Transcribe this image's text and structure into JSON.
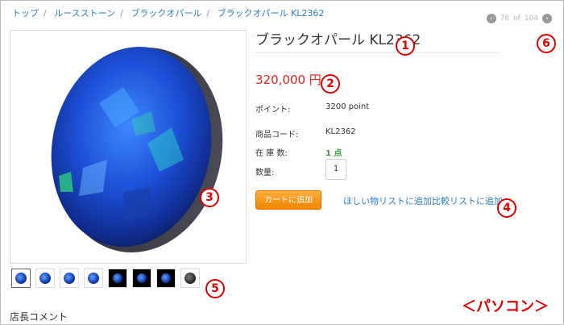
{
  "breadcrumb": [
    "トップ",
    "ルースストーン",
    "ブラックオパール",
    "ブラックオパール KL2362"
  ],
  "pager": {
    "current": "76",
    "of_text": "of",
    "total": "104",
    "prev_icon": "chevron-left-icon",
    "next_icon": "chevron-right-icon"
  },
  "product": {
    "title": "ブラックオパール KL2362",
    "price": "320,000 円",
    "points_label": "ポイント:",
    "points_value": "3200 point",
    "code_label": "商品コード:",
    "code_value": "KL2362",
    "stock_label": "在 庫 数:",
    "stock_value": "1 点",
    "qty_label": "数量:",
    "qty_value": "1"
  },
  "actions": {
    "cart_label": "カートに追加",
    "wishlist_label": "ほしい物リストに追加",
    "compare_label": "比較リストに追加"
  },
  "badges": [
    "1",
    "2",
    "3",
    "4",
    "5",
    "6"
  ],
  "footer": {
    "shop_comment": "店長コメント",
    "pc_label": "＜パソコン＞"
  },
  "colors": {
    "price": "#e4231b",
    "link": "#2a7fc4",
    "button": "#f39a1e",
    "stock": "#2e9a38",
    "annotation": "#e00000"
  }
}
